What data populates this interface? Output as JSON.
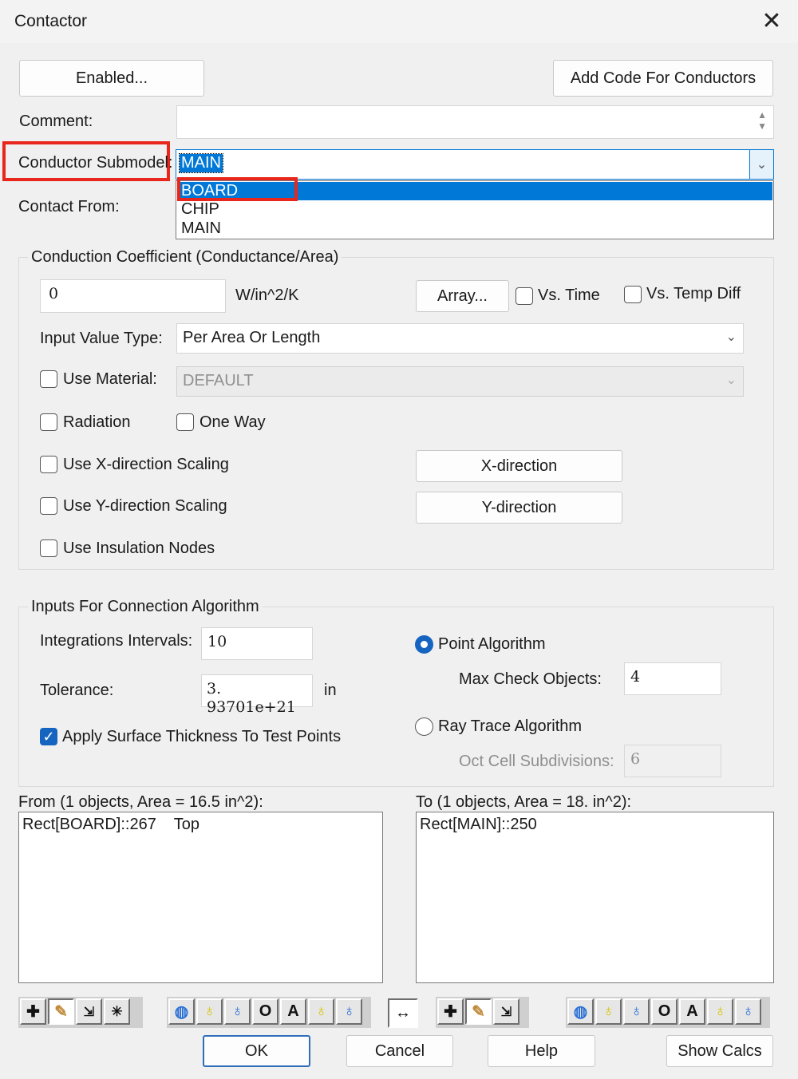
{
  "window": {
    "title": "Contactor"
  },
  "top_buttons": {
    "enabled": "Enabled...",
    "add_code": "Add Code For Conductors"
  },
  "comment": {
    "label": "Comment:",
    "value": ""
  },
  "submodel": {
    "label": "Conductor Submodel:",
    "value": "MAIN",
    "options": [
      "BOARD",
      "CHIP",
      "MAIN"
    ],
    "highlighted": "BOARD"
  },
  "contact_from": {
    "label": "Contact From:"
  },
  "conduction": {
    "title": "Conduction Coefficient (Conductance/Area)",
    "value": "0",
    "units": "W/in^2/K",
    "array_button": "Array...",
    "vs_time": "Vs. Time",
    "vs_temp_diff": "Vs. Temp Diff",
    "input_value_type_label": "Input Value Type:",
    "input_value_type": "Per Area Or Length",
    "use_material": "Use Material:",
    "material": "DEFAULT",
    "radiation": "Radiation",
    "one_way": "One Way",
    "use_x_scaling": "Use X-direction Scaling",
    "x_direction_button": "X-direction",
    "use_y_scaling": "Use Y-direction Scaling",
    "y_direction_button": "Y-direction",
    "use_insulation": "Use Insulation Nodes"
  },
  "algorithm": {
    "title": "Inputs For Connection Algorithm",
    "integrations_label": "Integrations Intervals:",
    "integrations_value": "10",
    "tolerance_label": "Tolerance:",
    "tolerance_value": "3. 93701e+21",
    "tolerance_units": "in",
    "apply_surface": "Apply Surface Thickness To Test Points",
    "apply_surface_checked": true,
    "point_algorithm": "Point Algorithm",
    "max_check_label": "Max Check Objects:",
    "max_check_value": "4",
    "ray_trace": "Ray Trace Algorithm",
    "oct_cell_label": "Oct Cell Subdivisions:",
    "oct_cell_value": "6"
  },
  "from_list": {
    "label": "From (1 objects, Area = 16.5 in^2):",
    "item": "Rect[BOARD]::267    Top"
  },
  "to_list": {
    "label": "To (1 objects, Area = 18. in^2):",
    "item": "Rect[MAIN]::250"
  },
  "toolbar": {
    "add_icon": "plus-icon",
    "edit_icon": "pencil-icon",
    "select_icon": "select-arrow-icon",
    "star_icon": "star-select-icon",
    "node_a_icon": "node-globe-icon",
    "bulb_d_icon": "bulb-d-icon",
    "bulb_b_icon": "bulb-b-icon",
    "o_label": "O",
    "a_label": "A",
    "swap_label": "↔"
  },
  "bottom_buttons": {
    "ok": "OK",
    "cancel": "Cancel",
    "help": "Help",
    "show_calcs": "Show Calcs"
  },
  "colors": {
    "accent": "#1565c0",
    "highlight_box": "#e8261b",
    "selection": "#0078d7"
  }
}
